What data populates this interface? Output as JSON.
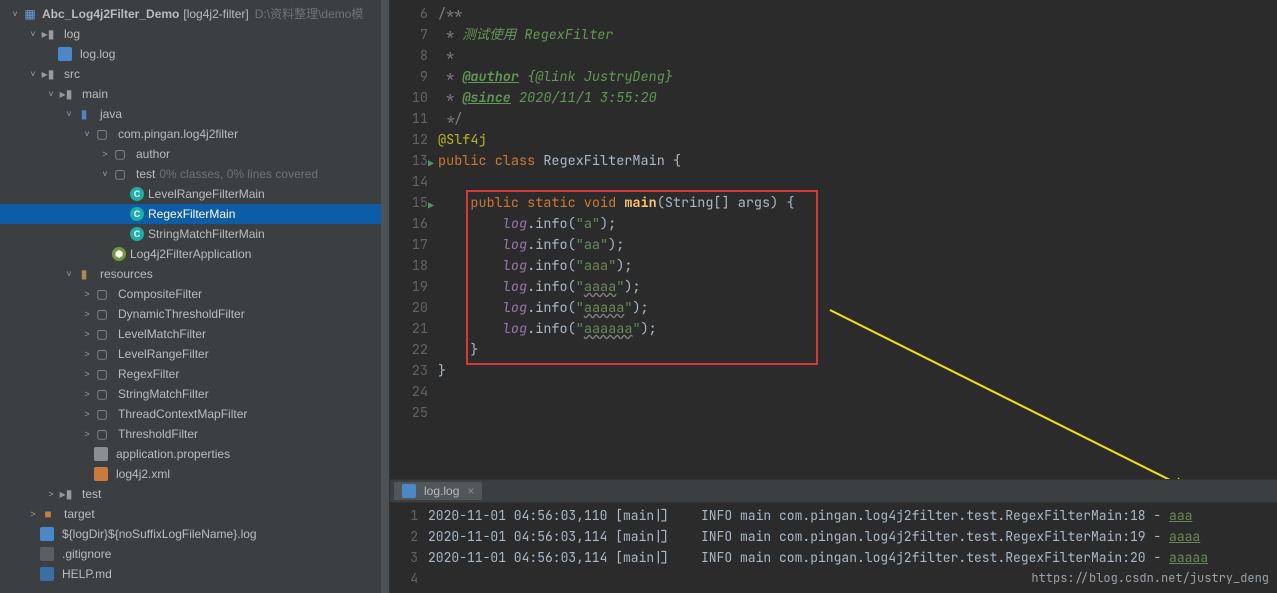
{
  "sidebar": {
    "project": {
      "name": "Abc_Log4j2Filter_Demo",
      "module": "[log4j2-filter]",
      "path": "D:\\资料整理\\demo模板"
    },
    "tree": [
      {
        "depth": 0,
        "arrow": "˅",
        "icon": "module",
        "label": "Abc_Log4j2Filter_Demo",
        "suffix": "[log4j2-filter]",
        "path": "D:\\资料整理\\demo模"
      },
      {
        "depth": 1,
        "arrow": "˅",
        "icon": "folder",
        "label": "log"
      },
      {
        "depth": 2,
        "arrow": "",
        "icon": "logfile",
        "label": "log.log"
      },
      {
        "depth": 1,
        "arrow": "˅",
        "icon": "folder",
        "label": "src"
      },
      {
        "depth": 2,
        "arrow": "˅",
        "icon": "folder",
        "label": "main"
      },
      {
        "depth": 3,
        "arrow": "˅",
        "icon": "folder-blue",
        "label": "java"
      },
      {
        "depth": 4,
        "arrow": "˅",
        "icon": "package",
        "label": "com.pingan.log4j2filter"
      },
      {
        "depth": 5,
        "arrow": "˃",
        "icon": "package",
        "label": "author"
      },
      {
        "depth": 5,
        "arrow": "˅",
        "icon": "package",
        "label": "test",
        "suffix": "0% classes, 0% lines covered"
      },
      {
        "depth": 6,
        "arrow": "",
        "icon": "class",
        "label": "LevelRangeFilterMain"
      },
      {
        "depth": 6,
        "arrow": "",
        "icon": "class",
        "label": "RegexFilterMain",
        "selected": true
      },
      {
        "depth": 6,
        "arrow": "",
        "icon": "class",
        "label": "StringMatchFilterMain"
      },
      {
        "depth": 5,
        "arrow": "",
        "icon": "spring",
        "label": "Log4j2FilterApplication"
      },
      {
        "depth": 3,
        "arrow": "˅",
        "icon": "folder-res",
        "label": "resources"
      },
      {
        "depth": 4,
        "arrow": "˃",
        "icon": "package",
        "label": "CompositeFilter"
      },
      {
        "depth": 4,
        "arrow": "˃",
        "icon": "package",
        "label": "DynamicThresholdFilter"
      },
      {
        "depth": 4,
        "arrow": "˃",
        "icon": "package",
        "label": "LevelMatchFilter"
      },
      {
        "depth": 4,
        "arrow": "˃",
        "icon": "package",
        "label": "LevelRangeFilter"
      },
      {
        "depth": 4,
        "arrow": "˃",
        "icon": "package",
        "label": "RegexFilter"
      },
      {
        "depth": 4,
        "arrow": "˃",
        "icon": "package",
        "label": "StringMatchFilter"
      },
      {
        "depth": 4,
        "arrow": "˃",
        "icon": "package",
        "label": "ThreadContextMapFilter"
      },
      {
        "depth": 4,
        "arrow": "˃",
        "icon": "package",
        "label": "ThresholdFilter"
      },
      {
        "depth": 4,
        "arrow": "",
        "icon": "props",
        "label": "application.properties"
      },
      {
        "depth": 4,
        "arrow": "",
        "icon": "xml",
        "label": "log4j2.xml"
      },
      {
        "depth": 2,
        "arrow": "˃",
        "icon": "folder",
        "label": "test"
      },
      {
        "depth": 1,
        "arrow": "˃",
        "icon": "orange-folder",
        "label": "target"
      },
      {
        "depth": 1,
        "arrow": "",
        "icon": "logfile",
        "label": "${logDir}${noSuffixLogFileName}.log"
      },
      {
        "depth": 1,
        "arrow": "",
        "icon": "text",
        "label": ".gitignore"
      },
      {
        "depth": 1,
        "arrow": "",
        "icon": "md",
        "label": "HELP.md"
      }
    ]
  },
  "editor": {
    "startLine": 6,
    "lines": [
      {
        "n": 6,
        "html": "<span class='cl-comment'>/**</span>"
      },
      {
        "n": 7,
        "html": "<span class='cl-comment'> * </span><span class='cl-doc'>测试使用 RegexFilter</span>"
      },
      {
        "n": 8,
        "html": "<span class='cl-comment'> *</span>"
      },
      {
        "n": 9,
        "html": "<span class='cl-comment'> * </span><span class='cl-doc-tag'>@author</span><span class='cl-doc'> {@link JustryDeng}</span>"
      },
      {
        "n": 10,
        "html": "<span class='cl-comment'> * </span><span class='cl-doc-tag'>@since</span><span class='cl-doc'> 2020/11/1 3:55:20</span>"
      },
      {
        "n": 11,
        "html": "<span class='cl-comment'> */</span>"
      },
      {
        "n": 12,
        "html": "<span class='cl-ann'>@Slf4j</span>"
      },
      {
        "n": 13,
        "html": "<span class='cl-kw'>public class </span><span class='cl-ident'>RegexFilterMain {</span>",
        "run": true
      },
      {
        "n": 14,
        "html": ""
      },
      {
        "n": 15,
        "html": "    <span class='cl-kw'>public static void </span><span class='cl-methodbold'>main</span><span class='cl-ident'>(String[] args) {</span>",
        "run": true
      },
      {
        "n": 16,
        "html": "        <span class='cl-static'>log</span><span class='cl-dot'>.</span><span class='cl-ident'>info(</span><span class='cl-str'>\"a\"</span><span class='cl-ident'>);</span>"
      },
      {
        "n": 17,
        "html": "        <span class='cl-static'>log</span><span class='cl-dot'>.</span><span class='cl-ident'>info(</span><span class='cl-str'>\"aa\"</span><span class='cl-ident'>);</span>"
      },
      {
        "n": 18,
        "html": "        <span class='cl-static'>log</span><span class='cl-dot'>.</span><span class='cl-ident'>info(</span><span class='cl-str'>\"aaa\"</span><span class='cl-ident'>);</span>"
      },
      {
        "n": 19,
        "html": "        <span class='cl-static'>log</span><span class='cl-dot'>.</span><span class='cl-ident'>info(</span><span class='cl-str'>\"<span class='underline-warn'>aaaa</span>\"</span><span class='cl-ident'>);</span>"
      },
      {
        "n": 20,
        "html": "        <span class='cl-static'>log</span><span class='cl-dot'>.</span><span class='cl-ident'>info(</span><span class='cl-str'>\"<span class='underline-warn'>aaaaa</span>\"</span><span class='cl-ident'>);</span>"
      },
      {
        "n": 21,
        "html": "        <span class='cl-static'>log</span><span class='cl-dot'>.</span><span class='cl-ident'>info(</span><span class='cl-str'>\"<span class='underline-warn'>aaaaaa</span>\"</span><span class='cl-ident'>);</span>"
      },
      {
        "n": 22,
        "html": "    <span class='cl-ident'>}</span>"
      },
      {
        "n": 23,
        "html": "<span class='cl-ident'>}</span>"
      },
      {
        "n": 24,
        "html": ""
      },
      {
        "n": 25,
        "html": ""
      }
    ]
  },
  "consoleTab": {
    "label": "log.log"
  },
  "console": [
    {
      "n": 1,
      "ts": "2020-11-01 04:56:03,110",
      "thread": "[main|]",
      "level": "INFO",
      "cat": "main",
      "cls": "com.pingan.log4j2filter.test.RegexFilterMain:18",
      "msg": "aaa"
    },
    {
      "n": 2,
      "ts": "2020-11-01 04:56:03,114",
      "thread": "[main|]",
      "level": "INFO",
      "cat": "main",
      "cls": "com.pingan.log4j2filter.test.RegexFilterMain:19",
      "msg": "aaaa"
    },
    {
      "n": 3,
      "ts": "2020-11-01 04:56:03,114",
      "thread": "[main|]",
      "level": "INFO",
      "cat": "main",
      "cls": "com.pingan.log4j2filter.test.RegexFilterMain:20",
      "msg": "aaaaa"
    },
    {
      "n": 4,
      "ts": "",
      "thread": "",
      "level": "",
      "cat": "",
      "cls": "",
      "msg": ""
    }
  ],
  "watermark": "https://blog.csdn.net/justry_deng"
}
